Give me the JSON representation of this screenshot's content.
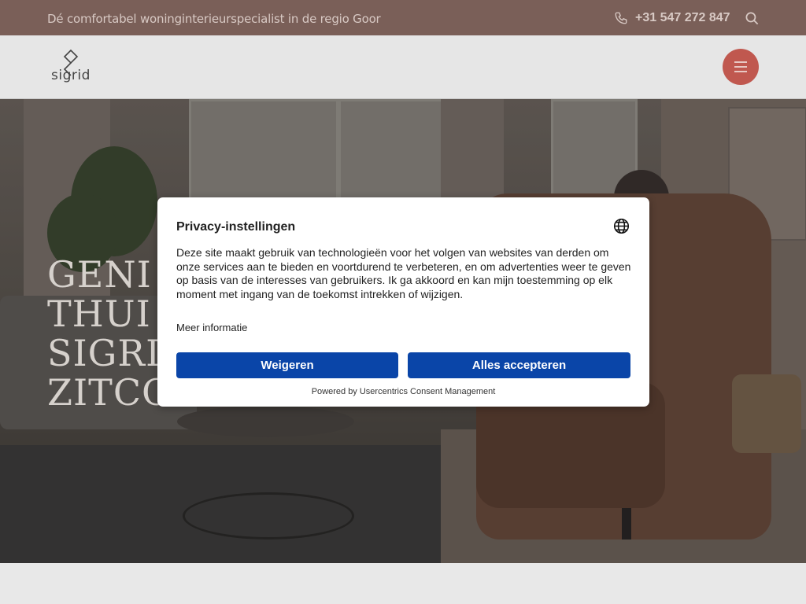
{
  "topbar": {
    "tagline": "Dé comfortabel woninginterieurspecialist in de regio Goor",
    "phone": "+31 547 272 847",
    "phone_icon": "phone-icon",
    "search_icon": "search-icon"
  },
  "header": {
    "logo_text": "sigrid",
    "menu_icon": "hamburger-icon"
  },
  "hero": {
    "title_lines": [
      "GENI",
      "THUI",
      "SIGRI",
      "ZITCO"
    ]
  },
  "consent": {
    "title": "Privacy-instellingen",
    "body": "Deze site maakt gebruik van technologieën voor het volgen van websites van derden om onze services aan te bieden en voortdurend te verbeteren, en om advertenties weer te geven op basis van de interesses van gebruikers. Ik ga akkoord en kan mijn toestemming op elk moment met ingang van de toekomst intrekken of wijzigen.",
    "more_info": "Meer informatie",
    "reject_label": "Weigeren",
    "accept_label": "Alles accepteren",
    "powered_by": "Powered by Usercentrics Consent Management",
    "language_icon": "globe-icon"
  },
  "colors": {
    "topbar": "#7a5f58",
    "menu_button": "#c0584f",
    "button_primary": "#0a45a8"
  }
}
